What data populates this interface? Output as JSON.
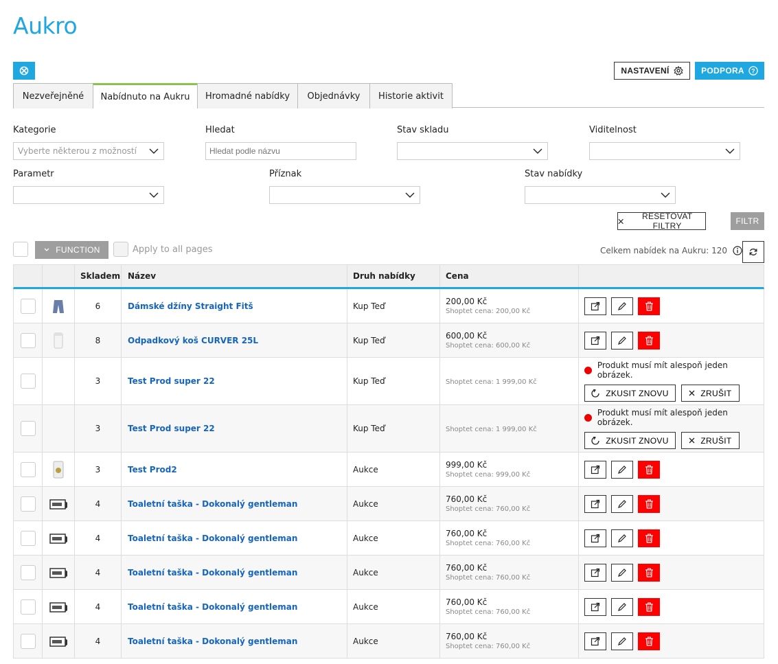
{
  "brand": "Aukro",
  "header": {
    "settings_label": "NASTAVENÍ",
    "support_label": "PODPORA"
  },
  "tabs": [
    {
      "label": "Nezveřejněné",
      "active": false
    },
    {
      "label": "Nabídnuto na Aukru",
      "active": true
    },
    {
      "label": "Hromadné nabídky",
      "active": false
    },
    {
      "label": "Objednávky",
      "active": false
    },
    {
      "label": "Historie aktivit",
      "active": false
    }
  ],
  "filters": {
    "category": {
      "label": "Kategorie",
      "placeholder": "Vyberte některou z možností"
    },
    "search": {
      "label": "Hledat",
      "placeholder": "Hledat podle názvu"
    },
    "stock_state": {
      "label": "Stav skladu",
      "value": ""
    },
    "visibility": {
      "label": "Viditelnost",
      "value": ""
    },
    "parameter": {
      "label": "Parametr",
      "value": ""
    },
    "flag": {
      "label": "Příznak",
      "value": ""
    },
    "offer_state": {
      "label": "Stav nabídky",
      "value": ""
    },
    "reset_label": "RESETOVAT FILTRY",
    "filter_label": "FILTR"
  },
  "toolbar": {
    "function_label": "FUNCTION",
    "apply_all_label": "Apply to all pages",
    "total_label": "Celkem nabídek na Aukru: 120"
  },
  "table": {
    "columns": [
      "",
      "",
      "Skladem",
      "Název",
      "Druh nabídky",
      "Cena",
      ""
    ],
    "error_message": "Produkt musí mít alespoň jeden obrázek.",
    "retry_label": "ZKUSIT ZNOVU",
    "cancel_label": "ZRUŠIT",
    "rows": [
      {
        "stock": "6",
        "name": "Dámské džíny Straight Fitš",
        "type": "Kup Teď",
        "price": "200,00 Kč",
        "shoptet": "Shoptet cena: 200,00 Kč",
        "thumb": "jeans-thumb",
        "error": false
      },
      {
        "stock": "8",
        "name": "Odpadkový koš CURVER 25L",
        "type": "Kup Teď",
        "price": "600,00 Kč",
        "shoptet": "Shoptet cena: 600,00 Kč",
        "thumb": "bin-thumb",
        "error": false
      },
      {
        "stock": "3",
        "name": "Test Prod super 22",
        "type": "Kup Teď",
        "price": "",
        "shoptet": "Shoptet cena: 1 999,00 Kč",
        "thumb": "",
        "error": true
      },
      {
        "stock": "3",
        "name": "Test Prod super 22",
        "type": "Kup Teď",
        "price": "",
        "shoptet": "Shoptet cena: 1 999,00 Kč",
        "thumb": "",
        "error": true
      },
      {
        "stock": "3",
        "name": "Test Prod2",
        "type": "Aukce",
        "price": "999,00 Kč",
        "shoptet": "Shoptet cena: 999,00 Kč",
        "thumb": "product-thumb",
        "error": false
      },
      {
        "stock": "4",
        "name": "Toaletní taška - Dokonalý gentleman",
        "type": "Aukce",
        "price": "760,00 Kč",
        "shoptet": "Shoptet cena: 760,00 Kč",
        "thumb": "bag-thumb",
        "error": false
      },
      {
        "stock": "4",
        "name": "Toaletní taška - Dokonalý gentleman",
        "type": "Aukce",
        "price": "760,00 Kč",
        "shoptet": "Shoptet cena: 760,00 Kč",
        "thumb": "bag-thumb",
        "error": false
      },
      {
        "stock": "4",
        "name": "Toaletní taška - Dokonalý gentleman",
        "type": "Aukce",
        "price": "760,00 Kč",
        "shoptet": "Shoptet cena: 760,00 Kč",
        "thumb": "bag-thumb",
        "error": false
      },
      {
        "stock": "4",
        "name": "Toaletní taška - Dokonalý gentleman",
        "type": "Aukce",
        "price": "760,00 Kč",
        "shoptet": "Shoptet cena: 760,00 Kč",
        "thumb": "bag-thumb",
        "error": false
      },
      {
        "stock": "4",
        "name": "Toaletní taška - Dokonalý gentleman",
        "type": "Aukce",
        "price": "760,00 Kč",
        "shoptet": "Shoptet cena: 760,00 Kč",
        "thumb": "bag-thumb",
        "error": false
      }
    ]
  },
  "colors": {
    "accent": "#1ea7e1",
    "active_tab": "#8bc34a",
    "danger": "#ff0000",
    "link": "#1565c0",
    "disabled": "#9e9e9e"
  }
}
